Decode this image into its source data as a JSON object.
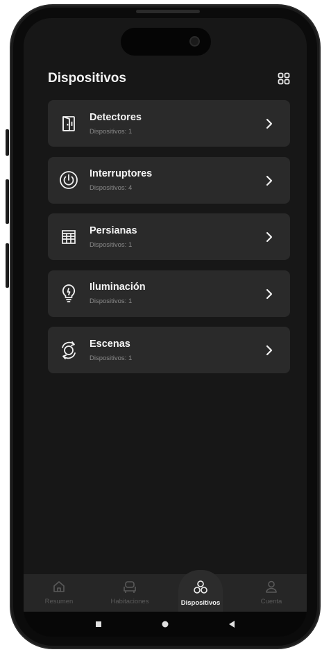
{
  "header": {
    "title": "Dispositivos"
  },
  "devices": [
    {
      "name": "Detectores",
      "count": "Dispositivos: 1",
      "icon": "door-sensor-icon"
    },
    {
      "name": "Interruptores",
      "count": "Dispositivos: 4",
      "icon": "power-icon"
    },
    {
      "name": "Persianas",
      "count": "Dispositivos: 1",
      "icon": "blinds-icon"
    },
    {
      "name": "Iluminación",
      "count": "Dispositivos: 1",
      "icon": "lightbulb-icon"
    },
    {
      "name": "Escenas",
      "count": "Dispositivos: 1",
      "icon": "scene-cycle-icon"
    }
  ],
  "tabs": [
    {
      "label": "Resumen",
      "icon": "home-icon",
      "active": false
    },
    {
      "label": "Habitaciones",
      "icon": "sofa-icon",
      "active": false
    },
    {
      "label": "Dispositivos",
      "icon": "devices-icon",
      "active": true
    },
    {
      "label": "Cuenta",
      "icon": "user-icon",
      "active": false
    }
  ],
  "colors": {
    "background": "#171717",
    "card": "#2a2a2a",
    "text": "#f4f4f4",
    "muted": "#8a8a8a",
    "tabbar": "#262626"
  }
}
